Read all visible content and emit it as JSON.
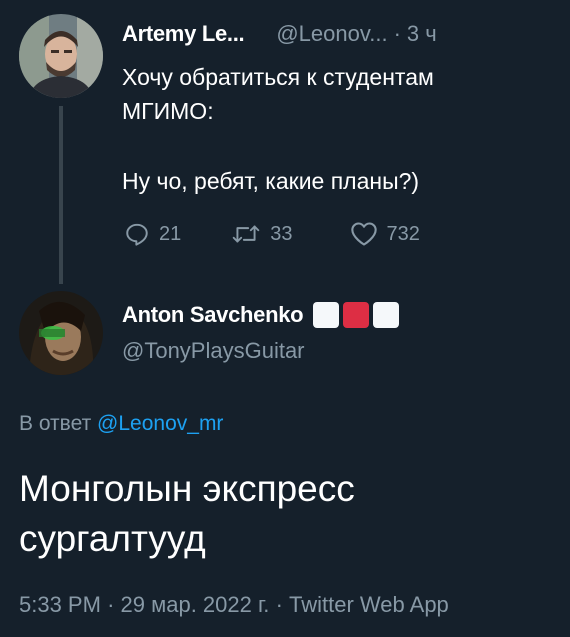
{
  "tweet1": {
    "author_name": "Artemy Le...",
    "handle": "@Leonov...",
    "separator": "·",
    "time": "3 ч",
    "text_lines": [
      "Хочу обратиться к студентам",
      "МГИМО:",
      "Ну чо, ребят, какие планы?)"
    ],
    "actions": {
      "reply_icon": "speech-bubble-icon",
      "reply_count": "21",
      "retweet_icon": "retweet-icon",
      "retweet_count": "33",
      "like_icon": "heart-icon",
      "like_count": "732"
    }
  },
  "tweet2": {
    "author_name": "Anton Savchenko",
    "name_emoji": [
      "white-square",
      "red-square",
      "white-square"
    ],
    "handle": "@TonyPlaysGuitar",
    "reply_prefix": "В ответ",
    "reply_to_handle": "@Leonov_mr",
    "text_lines": [
      "Монголын экспресс",
      "сургалтууд"
    ],
    "time": "5:33 PM",
    "sep": "·",
    "date": "29 мар. 2022 г.",
    "source": "Twitter Web App"
  },
  "colors": {
    "background": "#15202b",
    "muted": "#8899a6",
    "link": "#1da1f2",
    "flag_white": "#f5f8fa",
    "flag_red": "#dd2e44"
  }
}
